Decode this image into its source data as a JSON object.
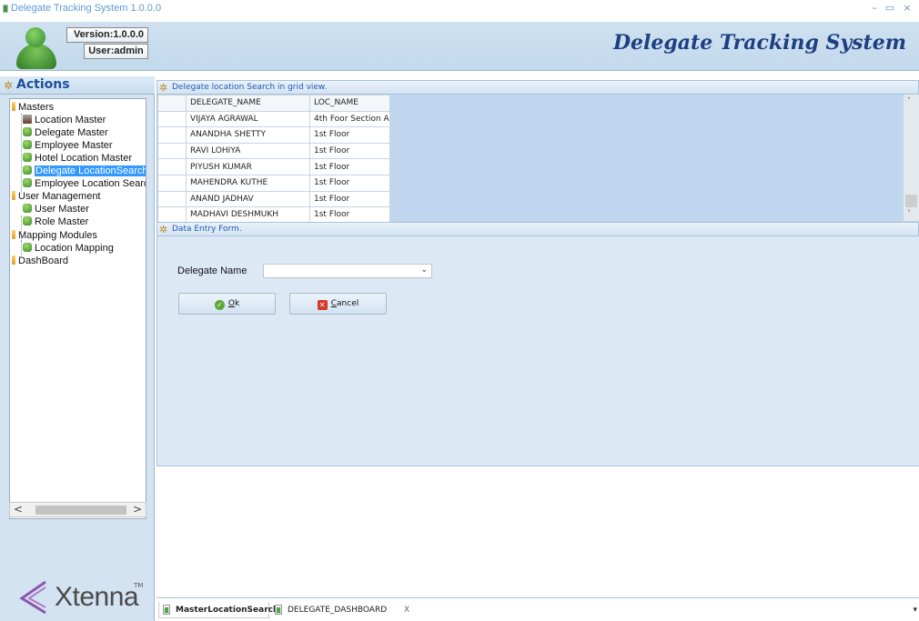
{
  "window": {
    "title": "Delegate Tracking System 1.0.0.0",
    "minimize": "–",
    "maximize": "▭",
    "close": "×"
  },
  "header": {
    "version": "Version:1.0.0.0",
    "user": "User:admin",
    "brand": "Delegate Tracking System"
  },
  "actions": {
    "title": "Actions"
  },
  "tree": [
    {
      "label": "Masters",
      "level": 0,
      "icon": "folder-icon"
    },
    {
      "label": "Location Master",
      "level": 1,
      "icon": "network-icon"
    },
    {
      "label": "Delegate Master",
      "level": 1,
      "icon": "user-icon"
    },
    {
      "label": "Employee Master",
      "level": 1,
      "icon": "user-icon"
    },
    {
      "label": "Hotel Location Master",
      "level": 1,
      "icon": "user-icon"
    },
    {
      "label": "Delegate LocationSearch",
      "level": 1,
      "icon": "user-icon",
      "selected": true
    },
    {
      "label": "Employee Location Searc",
      "level": 1,
      "icon": "user-icon"
    },
    {
      "label": "User Management",
      "level": 0,
      "icon": "folder-icon"
    },
    {
      "label": "User Master",
      "level": 1,
      "icon": "user-icon"
    },
    {
      "label": "Role Master",
      "level": 1,
      "icon": "user-icon"
    },
    {
      "label": "Mapping Modules",
      "level": 0,
      "icon": "folder-icon"
    },
    {
      "label": "Location Mapping",
      "level": 1,
      "icon": "user-icon"
    },
    {
      "label": "DashBoard",
      "level": 0,
      "icon": "folder-icon"
    }
  ],
  "tree_scroll": {
    "left": "<",
    "right": ">"
  },
  "logo": {
    "text": "Xtenna",
    "tm": "TM"
  },
  "grid_section": {
    "title": "Delegate  location Search  in grid view."
  },
  "grid": {
    "columns": [
      "DELEGATE_NAME",
      "LOC_NAME"
    ],
    "rows": [
      [
        "VIJAYA AGRAWAL",
        "4th Foor Section A"
      ],
      [
        "ANANDHA SHETTY",
        "1st Floor"
      ],
      [
        "RAVI LOHIYA",
        "1st Floor"
      ],
      [
        "PIYUSH KUMAR",
        "1st Floor"
      ],
      [
        "MAHENDRA KUTHE",
        "1st Floor"
      ],
      [
        "ANAND JADHAV",
        "1st Floor"
      ],
      [
        "MADHAVI DESHMUKH",
        "1st Floor"
      ]
    ]
  },
  "form_section": {
    "title": "Data Entry Form."
  },
  "form": {
    "delegate_label": "Delegate Name",
    "delegate_value": "",
    "ok_label": "Ok",
    "ok_accel": "O",
    "ok_rest": "k",
    "cancel_accel": "C",
    "cancel_rest": "ancel"
  },
  "tabs": [
    {
      "label": "MasterLocationSearch",
      "active": true
    },
    {
      "label": "DELEGATE_DASHBOARD",
      "active": false,
      "close": "X"
    }
  ]
}
